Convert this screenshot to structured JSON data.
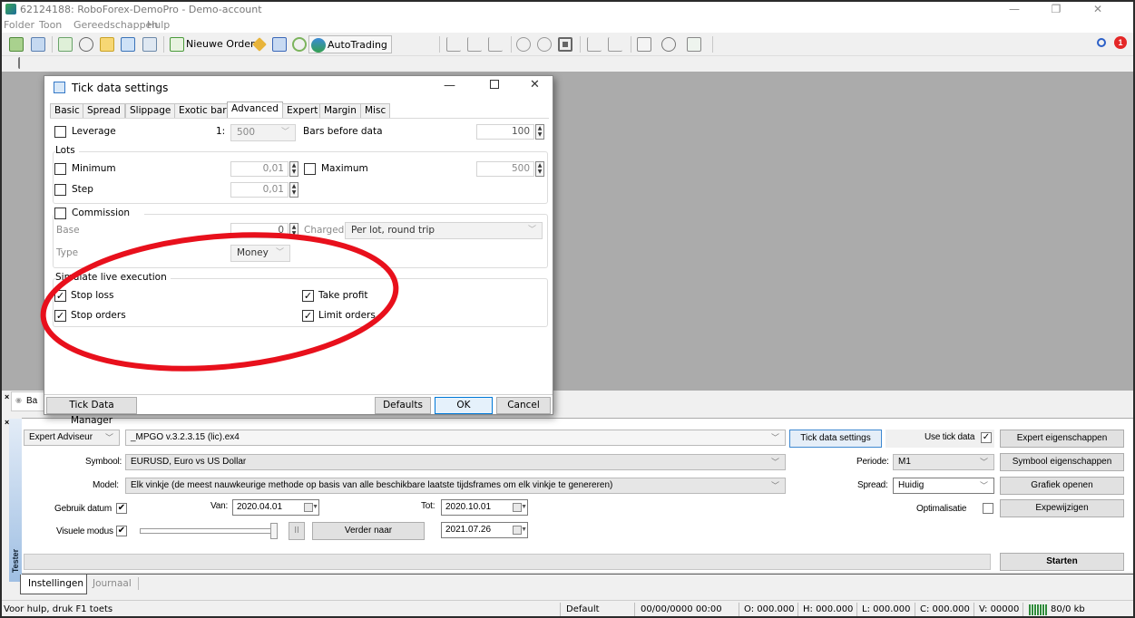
{
  "window": {
    "title": "62124188: RoboForex-DemoPro - Demo-account",
    "controls": {
      "minimize": "—",
      "restore": "❐",
      "close": "✕"
    }
  },
  "menu": [
    "Folder",
    "Toon",
    "Gereedschappen",
    "Hulp"
  ],
  "toolbar": {
    "new_order_label": "Nieuwe Order",
    "autotrading_label": "AutoTrading",
    "notification_count": "1",
    "icons": [
      "new-chart-icon",
      "profiles-icon",
      "market-watch-icon",
      "crosshair-icon",
      "navigator-icon",
      "terminal-icon",
      "strategy-tester-icon",
      "new-order-icon",
      "metaeditor-icon",
      "community-icon",
      "signals-icon",
      "autotrading-icon",
      "bar-chart-icon",
      "candlestick-icon",
      "line-chart-icon",
      "zoom-in-icon",
      "zoom-out-icon",
      "tile-windows-icon",
      "chart-shift-icon",
      "autoscroll-icon",
      "indicators-icon",
      "periods-icon",
      "templates-icon",
      "search-icon",
      "notification-icon"
    ]
  },
  "dialog": {
    "title": "Tick data settings",
    "tabs": [
      {
        "label": "Basic",
        "active": false
      },
      {
        "label": "Spread",
        "active": false
      },
      {
        "label": "Slippage",
        "active": false
      },
      {
        "label": "Exotic bars",
        "active": false
      },
      {
        "label": "Advanced",
        "active": true
      },
      {
        "label": "Expert",
        "active": false
      },
      {
        "label": "Margin",
        "active": false
      },
      {
        "label": "Misc",
        "active": false
      }
    ],
    "leverage": {
      "label": "Leverage",
      "checked": false,
      "prefix": "1:",
      "value": "500"
    },
    "bars_before_data": {
      "label": "Bars before data",
      "value": "100"
    },
    "lots": {
      "title": "Lots",
      "minimum": {
        "label": "Minimum",
        "checked": false,
        "value": "0,01"
      },
      "maximum": {
        "label": "Maximum",
        "checked": false,
        "value": "500"
      },
      "step": {
        "label": "Step",
        "checked": false,
        "value": "0,01"
      }
    },
    "commission": {
      "title": "Commission",
      "checked": false,
      "base_label": "Base",
      "base_value": "0",
      "charged_label": "Charged",
      "charged_value": "Per lot, round trip",
      "type_label": "Type",
      "type_value": "Money"
    },
    "simulate": {
      "title": "Simulate live execution",
      "stop_loss": {
        "label": "Stop loss",
        "checked": true
      },
      "take_profit": {
        "label": "Take profit",
        "checked": true
      },
      "stop_orders": {
        "label": "Stop orders",
        "checked": true
      },
      "limit_orders": {
        "label": "Limit orders",
        "checked": true
      }
    },
    "buttons": {
      "tick_data_manager": "Tick Data Manager",
      "defaults": "Defaults",
      "ok": "OK",
      "cancel": "Cancel"
    },
    "annotation_color": "#e8101c"
  },
  "tester": {
    "hidden_tab_fragment": "Ba",
    "type_select": "Expert Adviseur",
    "expert_file": "_MPGO v.3.2.3.15 (lic).ex4",
    "symbol_label": "Symbool:",
    "symbol_value": "EURUSD, Euro vs US Dollar",
    "model_label": "Model:",
    "model_value": "Elk vinkje (de meest nauwkeurige methode op basis van alle beschikbare laatste tijdsframes om elk vinkje te genereren)",
    "use_date_label": "Gebruik datum",
    "use_date_checked": true,
    "from_label": "Van:",
    "from_value": "2020.04.01",
    "to_label": "Tot:",
    "to_value": "2020.10.01",
    "visual_mode_label": "Visuele modus",
    "visual_mode_checked": true,
    "visual_speed": 1.0,
    "pause_label": "II",
    "skip_to_label": "Verder naar",
    "skip_to_value": "2021.07.26",
    "tick_data_settings_btn": "Tick data settings",
    "use_tick_data_label": "Use tick data",
    "use_tick_data_checked": true,
    "period_label": "Periode:",
    "period_value": "M1",
    "spread_label": "Spread:",
    "spread_value": "Huidig",
    "optimization_label": "Optimalisatie",
    "optimization_checked": false,
    "expert_props_btn": "Expert eigenschappen",
    "symbol_props_btn": "Symbool eigenschappen",
    "open_chart_btn": "Grafiek openen",
    "modify_expert_btn": "Expewijzigen",
    "start_btn": "Starten",
    "progress": 0,
    "side_label": "Tester",
    "tabs": [
      {
        "label": "Instellingen",
        "active": true
      },
      {
        "label": "Journaal",
        "active": false
      }
    ]
  },
  "status": {
    "help": "Voor hulp, druk F1 toets",
    "profile": "Default",
    "datetime": "00/00/0000 00:00",
    "open": "O: 000.000",
    "high": "H: 000.000",
    "low": "L: 000.000",
    "close": "C: 000.000",
    "volume": "V: 00000",
    "traffic": "80/0 kb"
  }
}
